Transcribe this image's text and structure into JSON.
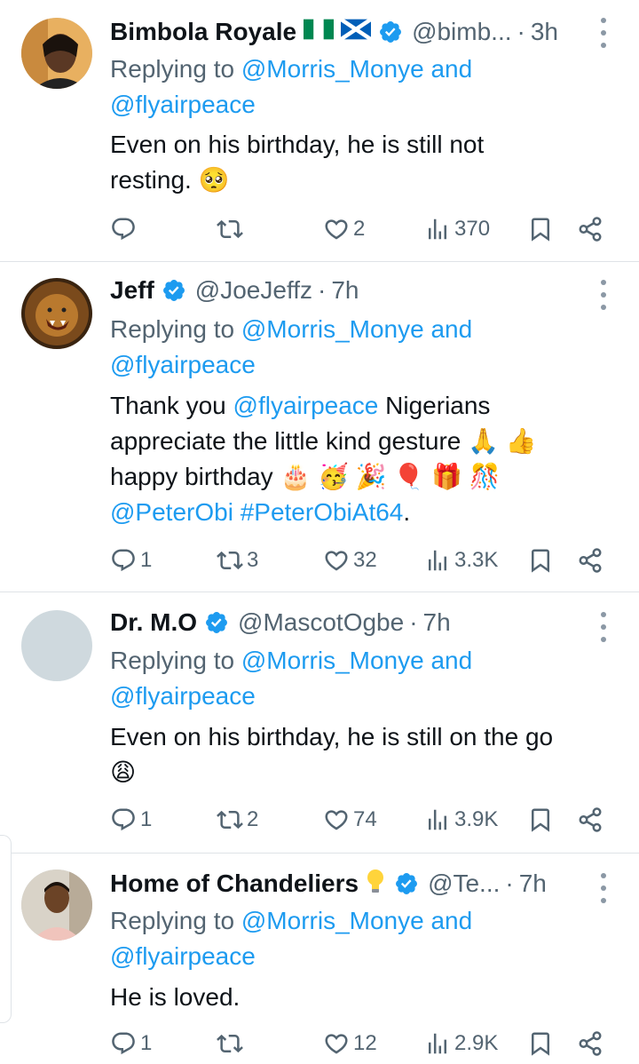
{
  "tweets": [
    {
      "name": "Bimbola Royale",
      "handle": "@bimb...",
      "sep": "·",
      "time": "3h",
      "replying_prefix": "Replying to ",
      "replying_to_1": "@Morris_Monye and",
      "replying_to_2": "@flyairpeace",
      "text_line1": "Even on his birthday,  he is still not",
      "text_line2": "resting. 🥺",
      "replies": "",
      "retweets": "",
      "likes": "2",
      "views": "370"
    },
    {
      "name": "Jeff",
      "handle": "@JoeJeffz",
      "sep": "·",
      "time": "7h",
      "replying_prefix": "Replying to ",
      "replying_to_1": "@Morris_Monye and",
      "replying_to_2": "@flyairpeace",
      "text_line1_a": "Thank you ",
      "text_line1_mention": "@flyairpeace",
      "text_line1_b": " Nigerians",
      "text_line2": "appreciate the little kind gesture 🙏 👍",
      "text_line3": "happy birthday 🎂 🥳 🎉 🎈 🎁 🎊",
      "text_line4_mention": "@PeterObi",
      "text_line4_hashtag": "#PeterObiAt64",
      "text_line4_end": ".",
      "replies": "1",
      "retweets": "3",
      "likes": "32",
      "views": "3.3K"
    },
    {
      "name": "Dr. M.O",
      "handle": "@MascotOgbe",
      "sep": "·",
      "time": "7h",
      "replying_prefix": "Replying to ",
      "replying_to_1": "@Morris_Monye and",
      "replying_to_2": "@flyairpeace",
      "text_line1": "Even on his birthday, he is still on the go",
      "text_line2": "😩",
      "replies": "1",
      "retweets": "2",
      "likes": "74",
      "views": "3.9K"
    },
    {
      "name": "Home of Chandeliers",
      "handle": "@Te...",
      "sep": "·",
      "time": "7h",
      "replying_prefix": "Replying to ",
      "replying_to_1": "@Morris_Monye and",
      "replying_to_2": "@flyairpeace",
      "text_line1": "He is loved.",
      "replies": "1",
      "retweets": "",
      "likes": "12",
      "views": "2.9K"
    }
  ],
  "colors": {
    "link": "#1d9bf0",
    "muted": "#536471",
    "verified": "#1d9bf0",
    "divider": "#dfe3e7"
  },
  "icons": [
    "reply-icon",
    "retweet-icon",
    "like-icon",
    "views-icon",
    "bookmark-icon",
    "share-icon",
    "verified-badge-icon",
    "more-options-icon"
  ]
}
